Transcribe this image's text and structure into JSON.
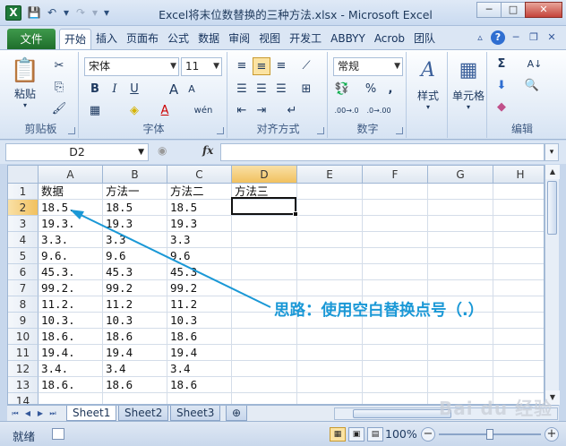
{
  "window": {
    "title": "Excel将末位数替换的三种方法.xlsx - Microsoft Excel",
    "app_icon": "X",
    "controls": {
      "minimize": "─",
      "maximize": "□",
      "close": "✕"
    }
  },
  "qat": {
    "save": "💾",
    "undo": "↶",
    "undo_dd": "▾",
    "redo": "↷",
    "redo_dd": "▾",
    "customize": "▾"
  },
  "ribbon_tabs": {
    "file": "文件",
    "tabs": [
      "开始",
      "插入",
      "页面布",
      "公式",
      "数据",
      "审阅",
      "视图",
      "开发工",
      "ABBYY",
      "Acrob",
      "团队"
    ],
    "active_index": 0,
    "right_icons": {
      "minimize_ribbon": "▵",
      "help": "?",
      "win_min": "─",
      "win_restore": "❐",
      "win_close": "✕"
    }
  },
  "ribbon": {
    "clipboard": {
      "label": "剪贴板",
      "paste": "粘贴",
      "paste_icon": "📋",
      "cut": "✂",
      "copy": "⎘",
      "format_painter": "🖌"
    },
    "font": {
      "label": "字体",
      "font_name": "宋体",
      "font_size": "11",
      "bold": "B",
      "italic": "I",
      "underline": "U",
      "grow": "A",
      "shrink": "A",
      "border": "▦",
      "fill": "◈",
      "font_color": "A",
      "phonetic": "wén"
    },
    "alignment": {
      "label": "对齐方式"
    },
    "number": {
      "label": "数字",
      "format": "常规",
      "currency": "💱",
      "percent": "%",
      "comma": ",",
      "inc_dec": ".00→.0",
      "dec_dec": ".0→.00"
    },
    "styles": {
      "label": "样式",
      "icon": "A"
    },
    "cells": {
      "label": "单元格",
      "icon": "▦"
    },
    "editing": {
      "label": "编辑",
      "sum": "Σ",
      "sort": "A↓",
      "find": "🔍",
      "fill": "⬇",
      "clear": "◆"
    }
  },
  "formula_bar": {
    "name_box": "D2",
    "fx": "fx",
    "value": ""
  },
  "columns": [
    "A",
    "B",
    "C",
    "D",
    "E",
    "F",
    "G",
    "H"
  ],
  "selected_column": "D",
  "rows": [
    "1",
    "2",
    "3",
    "4",
    "5",
    "6",
    "7",
    "8",
    "9",
    "10",
    "11",
    "12",
    "13",
    "14"
  ],
  "selected_row": "2",
  "cells": {
    "A": [
      "数据",
      "18.5.",
      "19.3.",
      "3.3.",
      "9.6.",
      "45.3.",
      "99.2.",
      "11.2.",
      "10.3.",
      "18.6.",
      "19.4.",
      "3.4.",
      "18.6."
    ],
    "B": [
      "方法一",
      "18.5",
      "19.3",
      "3.3",
      "9.6",
      "45.3",
      "99.2",
      "11.2",
      "10.3",
      "18.6",
      "19.4",
      "3.4",
      "18.6"
    ],
    "C": [
      "方法二",
      "18.5",
      "19.3",
      "3.3",
      "9.6",
      "45.3",
      "99.2",
      "11.2",
      "10.3",
      "18.6",
      "19.4",
      "3.4",
      "18.6"
    ],
    "D": [
      "方法三",
      "",
      "",
      "",
      "",
      "",
      "",
      "",
      "",
      "",
      "",
      "",
      ""
    ]
  },
  "sheets": [
    "Sheet1",
    "Sheet2",
    "Sheet3"
  ],
  "active_sheet": 0,
  "sheet_nav": [
    "⏮",
    "◀",
    "▶",
    "⏭"
  ],
  "status": {
    "mode": "就绪",
    "zoom": "100%",
    "zoom_minus": "−",
    "zoom_plus": "+"
  },
  "annotation": "思路：使用空白替换点号（.）",
  "watermark": "Bai du 经验",
  "colors": {
    "accent": "#1a98d6",
    "file_tab": "#2a7f37",
    "selection": "#f1c15f"
  }
}
